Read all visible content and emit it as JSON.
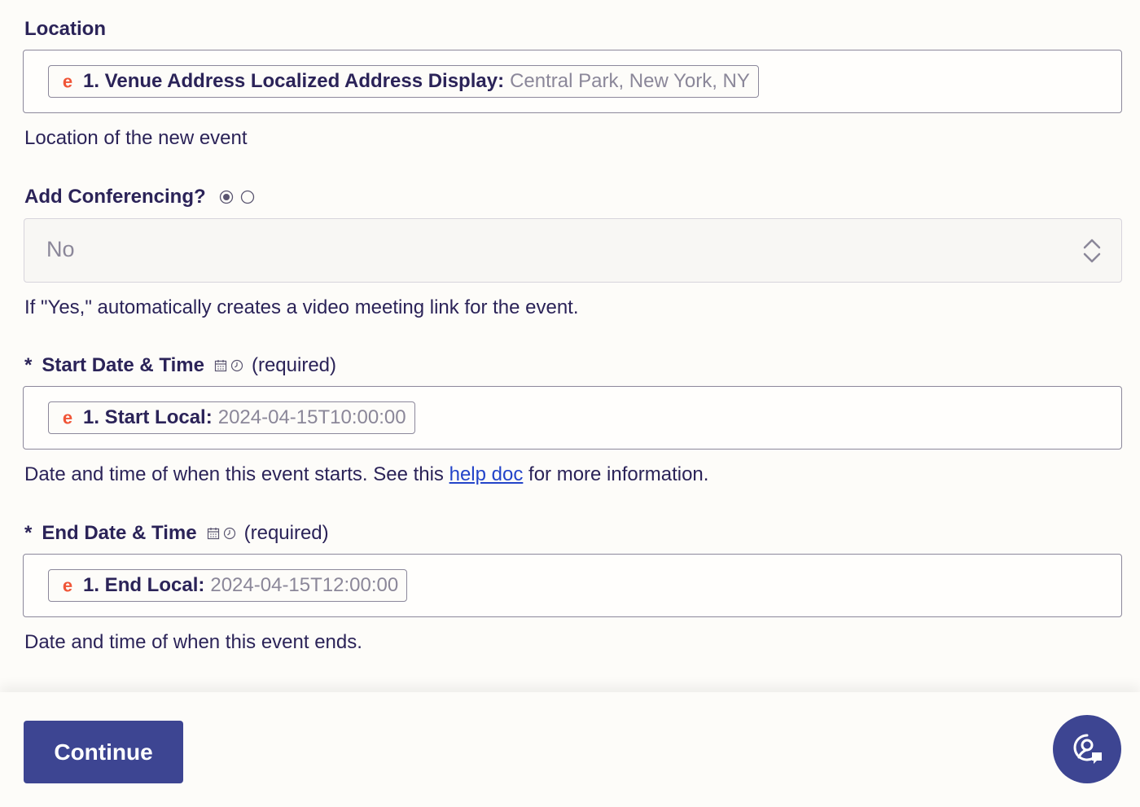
{
  "location": {
    "label": "Location",
    "pill_key": "1. Venue Address Localized Address Display:",
    "pill_value": "Central Park, New York, NY",
    "help": "Location of the new event"
  },
  "conferencing": {
    "label": "Add Conferencing?",
    "selected": "No",
    "help": "If \"Yes,\" automatically creates a video meeting link for the event."
  },
  "start": {
    "star": "*",
    "label": "Start Date & Time",
    "required": "(required)",
    "pill_key": "1. Start Local:",
    "pill_value": "2024-04-15T10:00:00",
    "help_before": "Date and time of when this event starts. See this",
    "help_link": "help doc",
    "help_after": "for more information."
  },
  "end": {
    "star": "*",
    "label": "End Date & Time",
    "required": "(required)",
    "pill_key": "1. End Local:",
    "pill_value": "2024-04-15T12:00:00",
    "help": "Date and time of when this event ends."
  },
  "footer": {
    "continue_label": "Continue"
  },
  "colors": {
    "primary": "#3d4592",
    "text": "#2b2358",
    "muted": "#8b8799",
    "link": "#2344c9",
    "eventbrite": "#f05537"
  }
}
